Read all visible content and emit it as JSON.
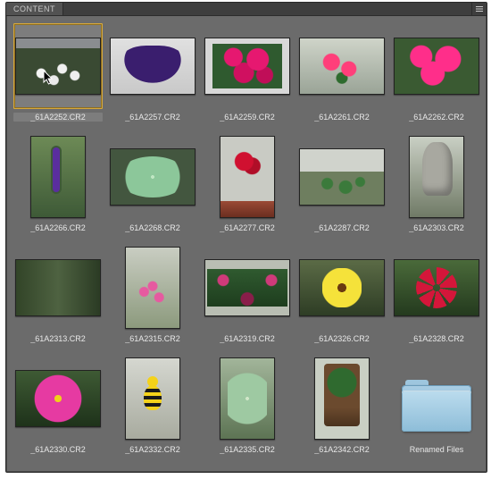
{
  "panel": {
    "tab_label": "CONTENT",
    "menu_icon": "panel-menu-icon"
  },
  "selected_index": 0,
  "items": [
    {
      "filename": "_61A2252.CR2",
      "orientation": "landscape",
      "art": "t0",
      "kind": "image"
    },
    {
      "filename": "_61A2257.CR2",
      "orientation": "landscape",
      "art": "t1",
      "kind": "image"
    },
    {
      "filename": "_61A2259.CR2",
      "orientation": "landscape",
      "art": "t2",
      "kind": "image"
    },
    {
      "filename": "_61A2261.CR2",
      "orientation": "landscape",
      "art": "t3",
      "kind": "image"
    },
    {
      "filename": "_61A2262.CR2",
      "orientation": "landscape",
      "art": "t4",
      "kind": "image"
    },
    {
      "filename": "_61A2266.CR2",
      "orientation": "portrait",
      "art": "t5",
      "kind": "image"
    },
    {
      "filename": "_61A2268.CR2",
      "orientation": "landscape",
      "art": "t6",
      "kind": "image"
    },
    {
      "filename": "_61A2277.CR2",
      "orientation": "portrait",
      "art": "t7",
      "kind": "image"
    },
    {
      "filename": "_61A2287.CR2",
      "orientation": "landscape",
      "art": "t8",
      "kind": "image"
    },
    {
      "filename": "_61A2303.CR2",
      "orientation": "portrait",
      "art": "t9",
      "kind": "image"
    },
    {
      "filename": "_61A2313.CR2",
      "orientation": "landscape",
      "art": "t10",
      "kind": "image"
    },
    {
      "filename": "_61A2315.CR2",
      "orientation": "portrait",
      "art": "t11",
      "kind": "image"
    },
    {
      "filename": "_61A2319.CR2",
      "orientation": "landscape",
      "art": "t12",
      "kind": "image"
    },
    {
      "filename": "_61A2326.CR2",
      "orientation": "landscape",
      "art": "t13",
      "kind": "image"
    },
    {
      "filename": "_61A2328.CR2",
      "orientation": "landscape",
      "art": "t14",
      "kind": "image"
    },
    {
      "filename": "_61A2330.CR2",
      "orientation": "landscape",
      "art": "t15",
      "kind": "image"
    },
    {
      "filename": "_61A2332.CR2",
      "orientation": "portrait",
      "art": "t16",
      "kind": "image"
    },
    {
      "filename": "_61A2335.CR2",
      "orientation": "portrait",
      "art": "t17",
      "kind": "image"
    },
    {
      "filename": "_61A2342.CR2",
      "orientation": "portrait",
      "art": "t18",
      "kind": "image"
    },
    {
      "filename": "Renamed Files",
      "orientation": "folder",
      "art": "",
      "kind": "folder"
    }
  ]
}
